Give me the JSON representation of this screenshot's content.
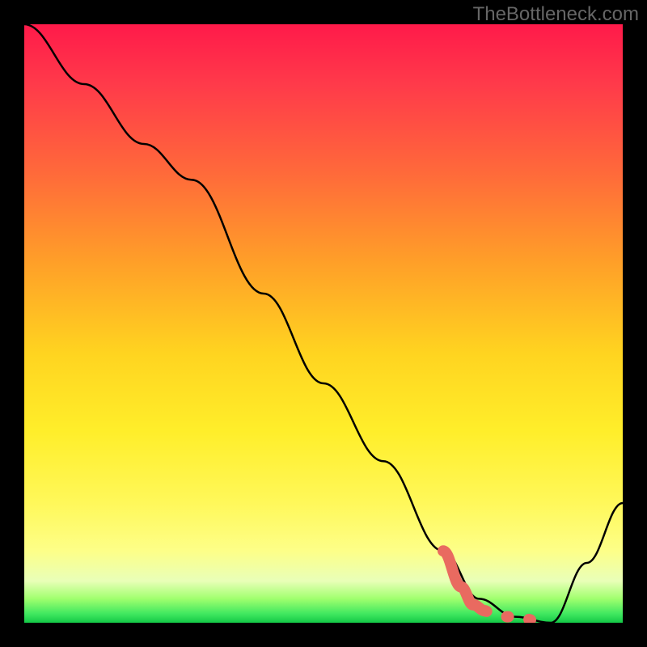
{
  "watermark": "TheBottleneck.com",
  "chart_data": {
    "type": "line",
    "title": "",
    "xlabel": "",
    "ylabel": "",
    "xlim": [
      0,
      100
    ],
    "ylim": [
      0,
      100
    ],
    "grid": false,
    "legend": false,
    "series": [
      {
        "name": "main-curve",
        "color": "#000000",
        "x": [
          0,
          10,
          20,
          28,
          40,
          50,
          60,
          70,
          76,
          82,
          88,
          94,
          100
        ],
        "y": [
          100,
          90,
          80,
          74,
          55,
          40,
          27,
          12,
          4,
          1,
          0,
          10,
          20
        ]
      },
      {
        "name": "highlight-segment",
        "color": "#e96a60",
        "style": "thick",
        "x": [
          70,
          73,
          75,
          77
        ],
        "y": [
          12,
          6,
          3,
          2
        ]
      },
      {
        "name": "highlight-dots",
        "color": "#e96a60",
        "style": "dotted",
        "x": [
          77,
          80,
          83,
          86,
          88
        ],
        "y": [
          2,
          1,
          1,
          0,
          0
        ]
      }
    ],
    "background": {
      "type": "vertical-gradient",
      "stops": [
        {
          "pct": 0,
          "color": "#ff1a4a"
        },
        {
          "pct": 25,
          "color": "#ff6a3a"
        },
        {
          "pct": 55,
          "color": "#ffd420"
        },
        {
          "pct": 80,
          "color": "#fff85a"
        },
        {
          "pct": 96,
          "color": "#a0ff6e"
        },
        {
          "pct": 100,
          "color": "#14c846"
        }
      ]
    }
  }
}
